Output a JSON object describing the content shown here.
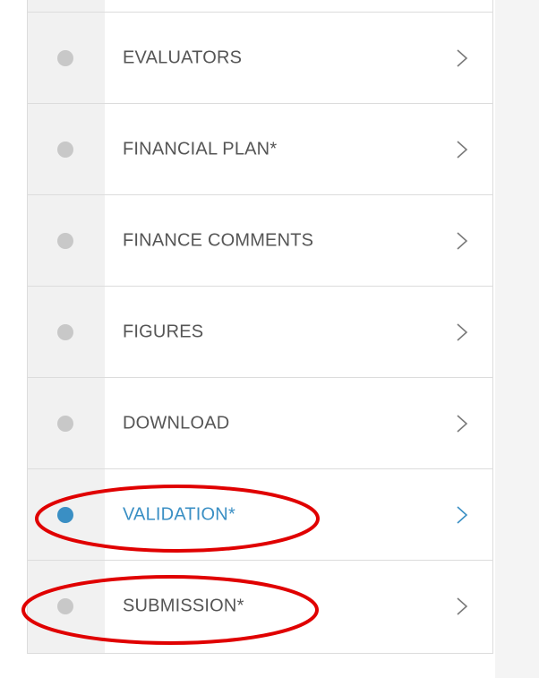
{
  "nav": {
    "items": [
      {
        "label": "EVALUATORS",
        "active": false,
        "circled": false
      },
      {
        "label": "FINANCIAL PLAN*",
        "active": false,
        "circled": false
      },
      {
        "label": "FINANCE COMMENTS",
        "active": false,
        "circled": false
      },
      {
        "label": "FIGURES",
        "active": false,
        "circled": false
      },
      {
        "label": "DOWNLOAD",
        "active": false,
        "circled": false
      },
      {
        "label": "VALIDATION*",
        "active": true,
        "circled": true
      },
      {
        "label": "SUBMISSION*",
        "active": false,
        "circled": true
      }
    ]
  },
  "colors": {
    "active": "#3a8fc4",
    "inactive_dot": "#c8c8c8",
    "label": "#555555",
    "chevron": "#7a7a7a",
    "annotation": "#e00000",
    "rail": "#f1f1f1",
    "divider": "#dcdcdc"
  },
  "icons": {
    "status": "status-dot-icon",
    "arrow": "chevron-right-icon"
  }
}
